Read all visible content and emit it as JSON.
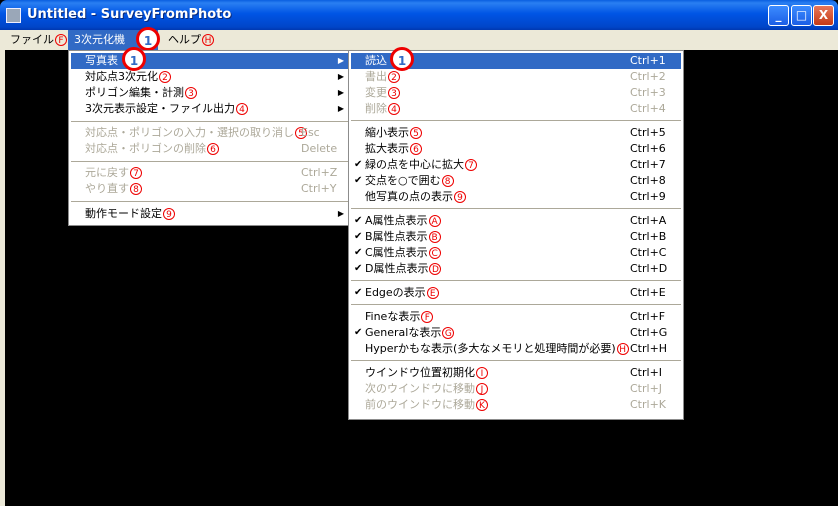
{
  "window": {
    "title": "Untitled - SurveyFromPhoto",
    "controls": [
      "_",
      "□",
      "X"
    ]
  },
  "menubar": [
    {
      "label": "ファイル",
      "mnemonic": "F"
    },
    {
      "label": "3次元化機",
      "mnemonic": "1"
    },
    {
      "label": "ヘルプ",
      "mnemonic": "H"
    }
  ],
  "menu_3d": {
    "items": [
      {
        "label": "写真表",
        "mnemonic": "1",
        "submenu": true,
        "highlight": true
      },
      {
        "label": "対応点3次元化",
        "mnemonic": "2",
        "submenu": true
      },
      {
        "label": "ポリゴン編集・計測",
        "mnemonic": "3",
        "submenu": true
      },
      {
        "label": "3次元表示設定・ファイル出力",
        "mnemonic": "4",
        "submenu": true
      },
      {
        "label": "対応点・ポリゴンの入力・選択の取り消し",
        "mnemonic": "5",
        "shortcut": "Esc",
        "disabled": true
      },
      {
        "label": "対応点・ポリゴンの削除",
        "mnemonic": "6",
        "shortcut": "Delete",
        "disabled": true
      },
      {
        "label": "元に戻す",
        "mnemonic": "7",
        "shortcut": "Ctrl+Z",
        "disabled": true
      },
      {
        "label": "やり直す",
        "mnemonic": "8",
        "shortcut": "Ctrl+Y",
        "disabled": true
      },
      {
        "label": "動作モード設定",
        "mnemonic": "9",
        "submenu": true
      }
    ]
  },
  "submenu_photo": {
    "items": [
      {
        "label": "読込",
        "mnemonic": "1",
        "shortcut": "Ctrl+1",
        "highlight": true
      },
      {
        "label": "書出",
        "mnemonic": "2",
        "shortcut": "Ctrl+2",
        "disabled": true
      },
      {
        "label": "変更",
        "mnemonic": "3",
        "shortcut": "Ctrl+3",
        "disabled": true
      },
      {
        "label": "削除",
        "mnemonic": "4",
        "shortcut": "Ctrl+4",
        "disabled": true
      },
      {
        "label": "縮小表示",
        "mnemonic": "5",
        "shortcut": "Ctrl+5"
      },
      {
        "label": "拡大表示",
        "mnemonic": "6",
        "shortcut": "Ctrl+6"
      },
      {
        "label": "緑の点を中心に拡大",
        "mnemonic": "7",
        "shortcut": "Ctrl+7",
        "checked": true
      },
      {
        "label": "交点を○で囲む",
        "mnemonic": "8",
        "shortcut": "Ctrl+8",
        "checked": true
      },
      {
        "label": "他写真の点の表示",
        "mnemonic": "9",
        "shortcut": "Ctrl+9"
      },
      {
        "label": "A属性点表示",
        "mnemonic": "A",
        "shortcut": "Ctrl+A",
        "checked": true
      },
      {
        "label": "B属性点表示",
        "mnemonic": "B",
        "shortcut": "Ctrl+B",
        "checked": true
      },
      {
        "label": "C属性点表示",
        "mnemonic": "C",
        "shortcut": "Ctrl+C",
        "checked": true
      },
      {
        "label": "D属性点表示",
        "mnemonic": "D",
        "shortcut": "Ctrl+D",
        "checked": true
      },
      {
        "label": "Edgeの表示",
        "mnemonic": "E",
        "shortcut": "Ctrl+E",
        "checked": true
      },
      {
        "label": "Fineな表示",
        "mnemonic": "F",
        "shortcut": "Ctrl+F"
      },
      {
        "label": "Generalな表示",
        "mnemonic": "G",
        "shortcut": "Ctrl+G",
        "checked": true
      },
      {
        "label": "Hyperかもな表示(多大なメモリと処理時間が必要)",
        "mnemonic": "H",
        "shortcut": "Ctrl+H"
      },
      {
        "label": "ウインドウ位置初期化",
        "mnemonic": "I",
        "shortcut": "Ctrl+I"
      },
      {
        "label": "次のウインドウに移動",
        "mnemonic": "J",
        "shortcut": "Ctrl+J",
        "disabled": true
      },
      {
        "label": "前のウインドウに移動",
        "mnemonic": "K",
        "shortcut": "Ctrl+K",
        "disabled": true
      }
    ]
  },
  "icons": {
    "check": "✔",
    "submenu_arrow": "▶"
  },
  "colors": {
    "titlebar": "#0055e5",
    "highlight": "#316ac5",
    "menu_bg": "#ece9d8",
    "disabled": "#aca899",
    "annotation": "#ee0000",
    "canvas": "#000000"
  }
}
